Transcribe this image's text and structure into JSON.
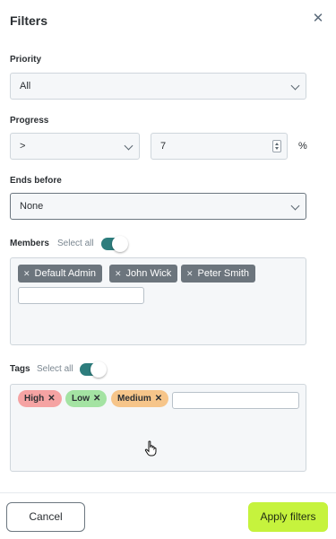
{
  "header": {
    "title": "Filters",
    "close_icon": "close-icon"
  },
  "priority": {
    "label": "Priority",
    "value": "All"
  },
  "progress": {
    "label": "Progress",
    "operator": ">",
    "value": "7",
    "unit": "%"
  },
  "ends_before": {
    "label": "Ends before",
    "value": "None"
  },
  "members": {
    "label": "Members",
    "select_all_label": "Select all",
    "select_all_on": true,
    "chips": [
      "Default Admin",
      "John Wick",
      "Peter Smith"
    ],
    "input_value": ""
  },
  "tags": {
    "label": "Tags",
    "select_all_label": "Select all",
    "select_all_on": true,
    "items": [
      {
        "label": "High",
        "color": "#f5a3a3"
      },
      {
        "label": "Low",
        "color": "#a4e3a3"
      },
      {
        "label": "Medium",
        "color": "#f6c58a"
      }
    ],
    "input_value": ""
  },
  "footer": {
    "cancel_label": "Cancel",
    "apply_label": "Apply filters"
  },
  "colors": {
    "accent": "#2d7d7d",
    "apply_button": "#c6f33d",
    "chip_bg": "#6c757d"
  }
}
